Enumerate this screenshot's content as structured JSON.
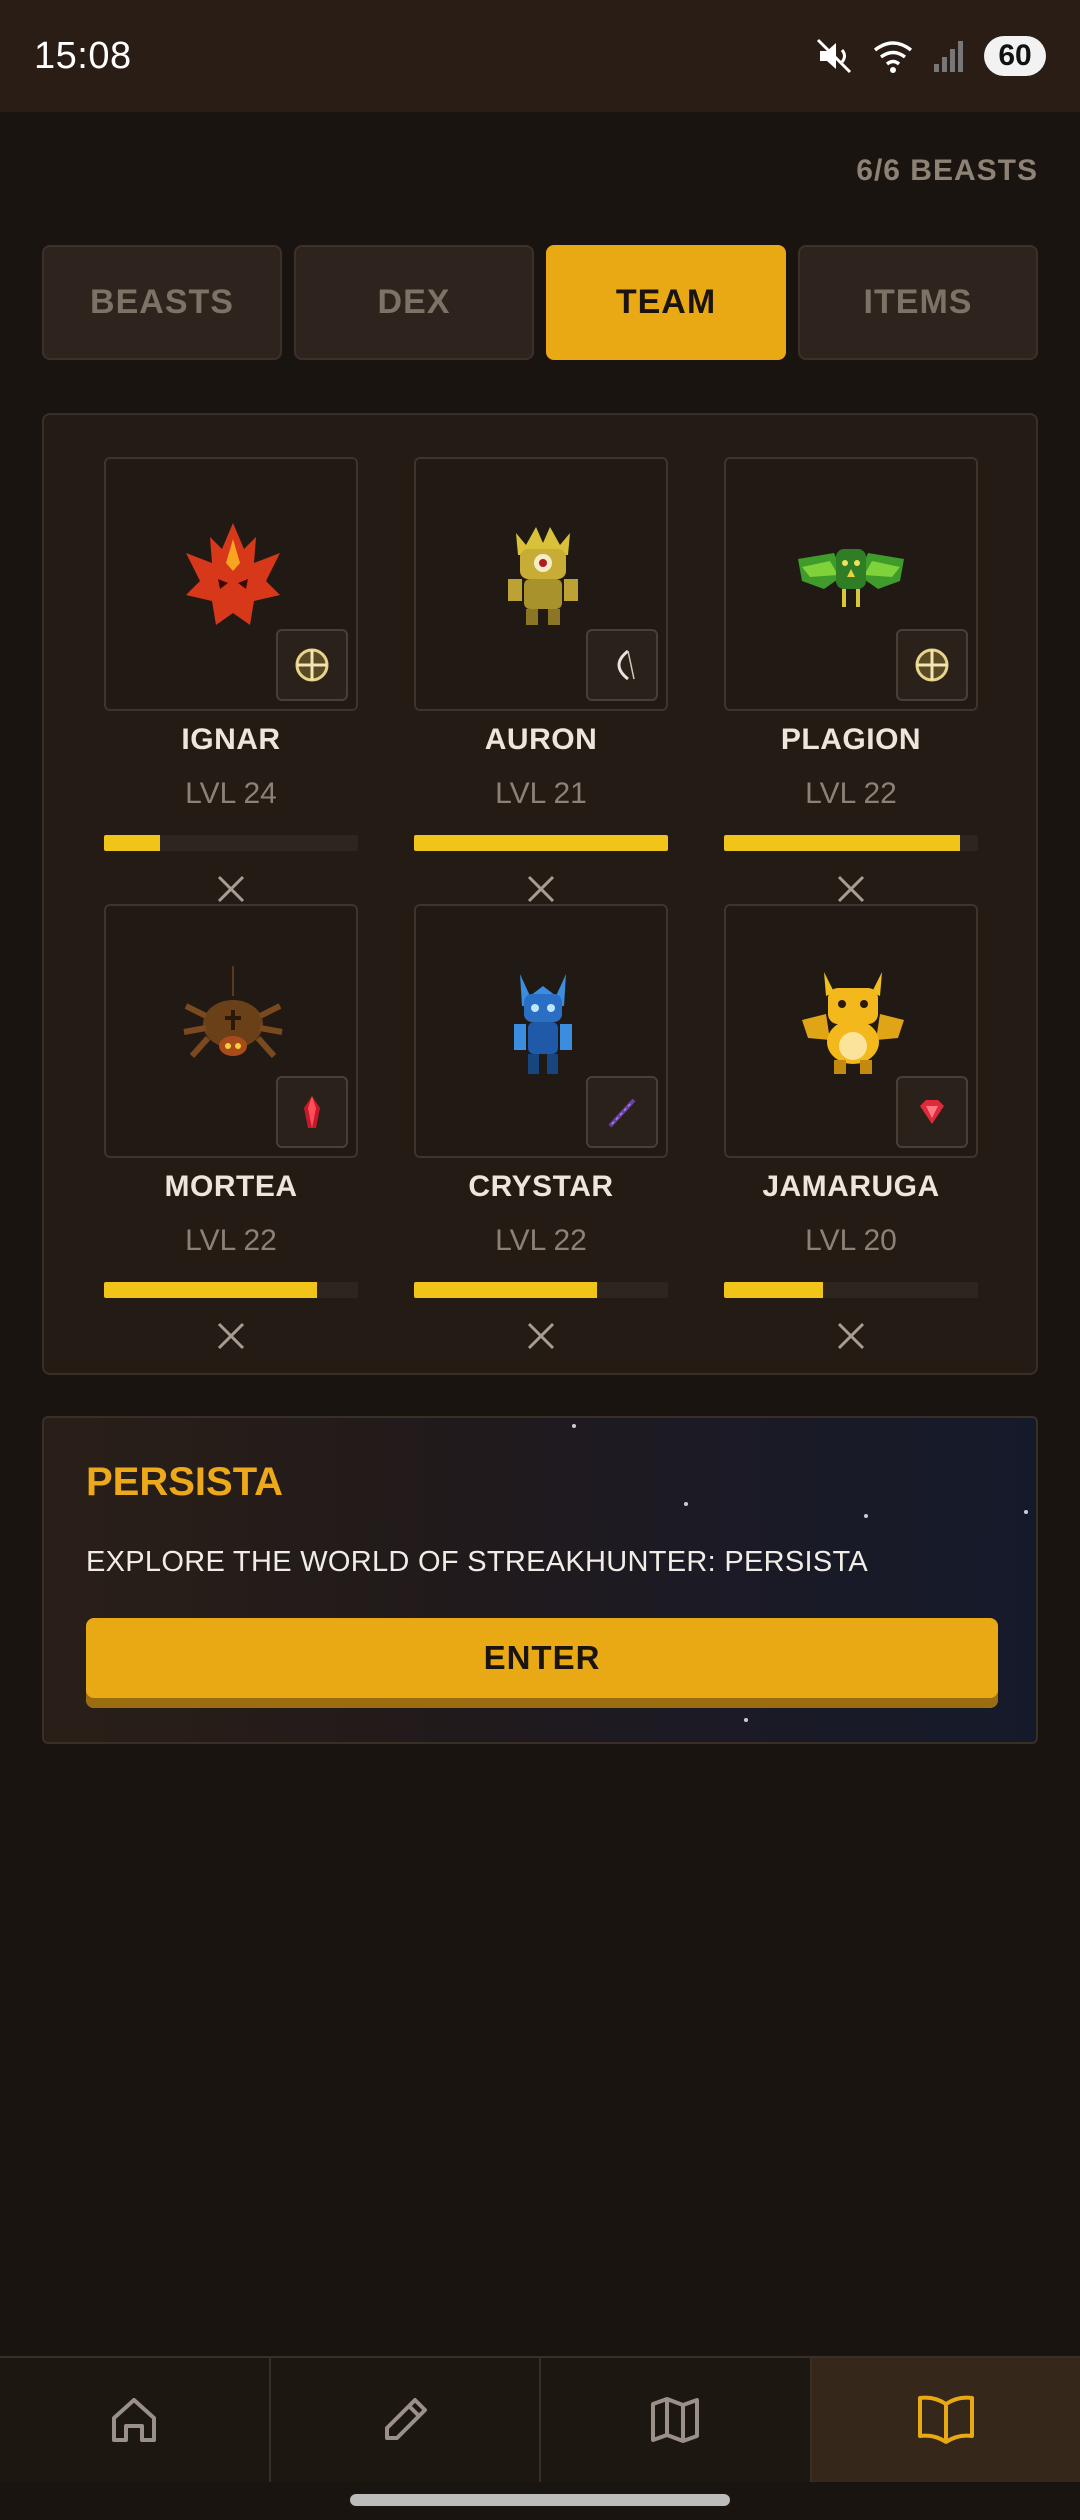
{
  "status_bar": {
    "time": "15:08",
    "battery": "60"
  },
  "header": {
    "beasts_count": "6/6 BEASTS"
  },
  "tabs": [
    {
      "label": "BEASTS",
      "active": false
    },
    {
      "label": "DEX",
      "active": false
    },
    {
      "label": "TEAM",
      "active": true
    },
    {
      "label": "ITEMS",
      "active": false
    }
  ],
  "team": [
    {
      "name": "IGNAR",
      "level": "LVL 24",
      "xp": 0.22,
      "item_icon": "crosshair-icon"
    },
    {
      "name": "AURON",
      "level": "LVL 21",
      "xp": 1.0,
      "item_icon": "bow-icon"
    },
    {
      "name": "PLAGION",
      "level": "LVL 22",
      "xp": 0.93,
      "item_icon": "crosshair-icon"
    },
    {
      "name": "MORTEA",
      "level": "LVL 22",
      "xp": 0.84,
      "item_icon": "red-crystal-icon"
    },
    {
      "name": "CRYSTAR",
      "level": "LVL 22",
      "xp": 0.72,
      "item_icon": "staff-icon"
    },
    {
      "name": "JAMARUGA",
      "level": "LVL 20",
      "xp": 0.39,
      "item_icon": "ruby-icon"
    }
  ],
  "world": {
    "title": "PERSISTA",
    "description": "EXPLORE THE WORLD OF STREAKHUNTER: PERSISTA",
    "button_label": "ENTER"
  },
  "bottom_nav": [
    {
      "icon": "home-icon",
      "active": false
    },
    {
      "icon": "pencil-icon",
      "active": false
    },
    {
      "icon": "map-icon",
      "active": false
    },
    {
      "icon": "book-icon",
      "active": true
    }
  ],
  "colors": {
    "accent": "#e8a915",
    "xp_bar": "#f0c419",
    "background": "#1a1410"
  }
}
